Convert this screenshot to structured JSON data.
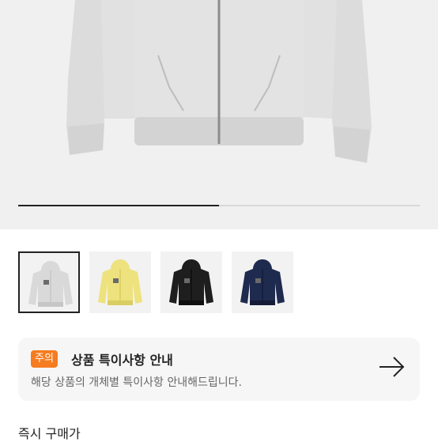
{
  "gallery": {
    "progress": 0.5,
    "thumbnails": [
      {
        "color": "gray",
        "fill": "#d9d9d9",
        "shade": "#c6c6c6",
        "selected": true
      },
      {
        "color": "yellow",
        "fill": "#ede27d",
        "shade": "#d9cd63",
        "selected": false
      },
      {
        "color": "black",
        "fill": "#1e1e1e",
        "shade": "#0f0f0f",
        "selected": false
      },
      {
        "color": "navy",
        "fill": "#1f2a4f",
        "shade": "#141c38",
        "selected": false
      }
    ]
  },
  "notice": {
    "badge": "주의",
    "title": "상품 특이사항 안내",
    "description": "해당 상품의 개체별 특이사항 안내해드립니다."
  },
  "price_section": {
    "title": "즉시 구매가"
  }
}
